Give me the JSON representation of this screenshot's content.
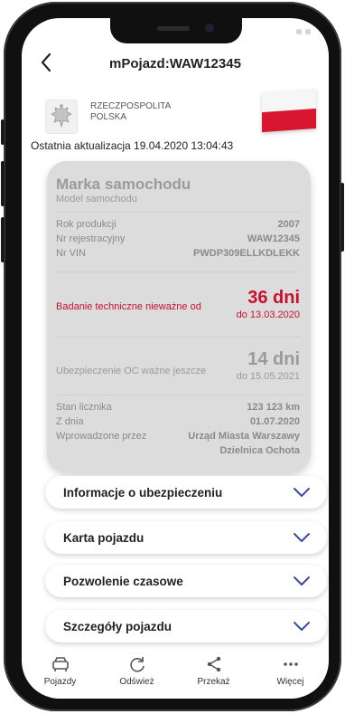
{
  "header": {
    "title": "mPojazd:WAW12345"
  },
  "country": {
    "line1": "RZECZPOSPOLITA",
    "line2": "POLSKA"
  },
  "last_update": "Ostatnia aktualizacja 19.04.2020 13:04:43",
  "vehicle": {
    "make": "Marka samochodu",
    "model": "Model samochodu",
    "details": [
      {
        "label": "Rok produkcji",
        "value": "2007"
      },
      {
        "label": "Nr rejestracyjny",
        "value": "WAW12345"
      },
      {
        "label": "Nr VIN",
        "value": "PWDP309ELLKDLEKK"
      }
    ],
    "inspection": {
      "label": "Badanie techniczne nieważne od",
      "days": "36 dni",
      "date": "do 13.03.2020"
    },
    "insurance": {
      "label": "Ubezpieczenie OC ważne jeszcze",
      "days": "14 dni",
      "date": "do 15.05.2021"
    },
    "odometer": [
      {
        "label": "Stan licznika",
        "value": "123 123 km"
      },
      {
        "label": "Z dnia",
        "value": "01.07.2020"
      },
      {
        "label": "Wprowadzone przez",
        "value1": "Urząd Miasta Warszawy",
        "value2": "Dzielnica Ochota"
      }
    ]
  },
  "sections": [
    {
      "label": "Informacje o ubezpieczeniu"
    },
    {
      "label": "Karta pojazdu"
    },
    {
      "label": "Pozwolenie czasowe"
    },
    {
      "label": "Szczegóły pojazdu"
    }
  ],
  "tabbar": [
    {
      "label": "Pojazdy",
      "icon": "car-icon"
    },
    {
      "label": "Odśwież",
      "icon": "refresh-icon"
    },
    {
      "label": "Przekaż",
      "icon": "share-icon"
    },
    {
      "label": "Więcej",
      "icon": "more-icon"
    }
  ],
  "colors": {
    "accent": "#3b4aa8",
    "alert": "#c8102e",
    "flag_red": "#d7172f"
  }
}
